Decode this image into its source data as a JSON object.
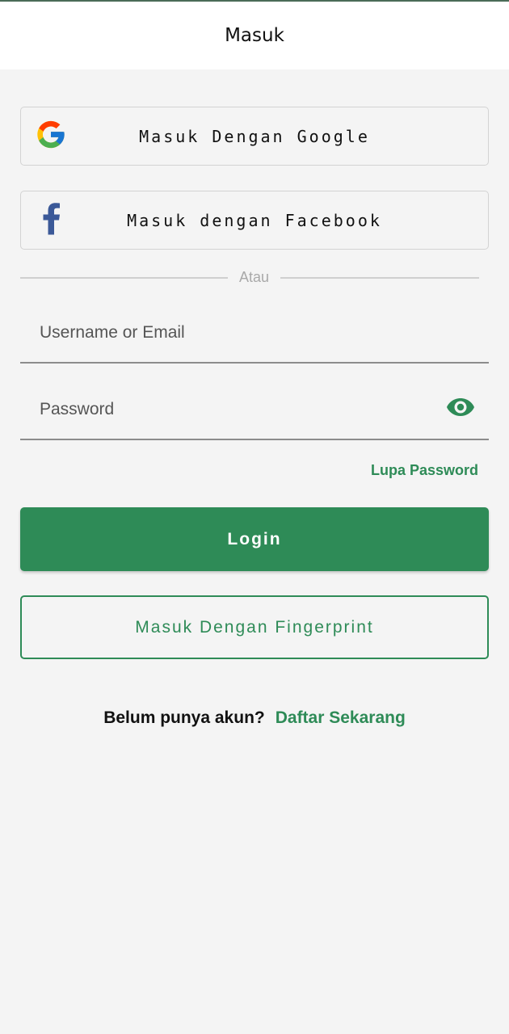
{
  "header": {
    "title": "Masuk"
  },
  "social": {
    "google_label": "Masuk Dengan Google",
    "facebook_label": "Masuk dengan Facebook",
    "google_icon": "google-g-icon",
    "facebook_icon": "facebook-f-icon"
  },
  "divider": {
    "label": "Atau"
  },
  "form": {
    "username_placeholder": "Username or Email",
    "username_value": "",
    "password_placeholder": "Password",
    "password_value": "",
    "eye_icon": "eye-icon",
    "forgot_label": "Lupa Password"
  },
  "actions": {
    "login_label": "Login",
    "fingerprint_label": "Masuk Dengan Fingerprint"
  },
  "register": {
    "question": "Belum punya akun?",
    "link_label": "Daftar Sekarang"
  },
  "colors": {
    "accent": "#2e8b57",
    "background": "#f4f4f4",
    "facebook_blue": "#3b5998"
  }
}
